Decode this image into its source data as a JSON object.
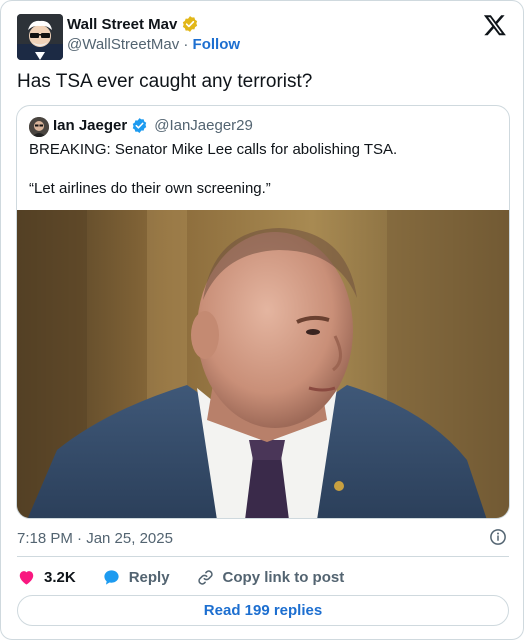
{
  "tweet": {
    "author": {
      "name": "Wall Street Mav",
      "handle": "@WallStreetMav",
      "separator": " · ",
      "follow_label": "Follow"
    },
    "text": "Has TSA ever caught any terrorist?",
    "quote": {
      "author_name": "Ian Jaeger",
      "author_handle": "@IanJaeger29",
      "line1": "BREAKING: Senator Mike Lee calls for abolishing TSA.",
      "line2": "“Let airlines do their own screening.”"
    },
    "timestamp": "7:18 PM · Jan 25, 2025",
    "actions": {
      "likes": "3.2K",
      "reply_label": "Reply",
      "copy_label": "Copy link to post"
    },
    "read_replies_label": "Read 199 replies"
  },
  "colors": {
    "link_blue": "#1d6fd0",
    "verified_gold": "#e2b719",
    "verified_blue": "#1d9bf0",
    "like_pink": "#f91880",
    "muted_text": "#536471",
    "border": "#cfd9de"
  },
  "icons": [
    "verified-gold-icon",
    "verified-blue-icon",
    "x-logo-icon",
    "info-icon",
    "heart-icon",
    "reply-bubble-icon",
    "link-icon"
  ]
}
